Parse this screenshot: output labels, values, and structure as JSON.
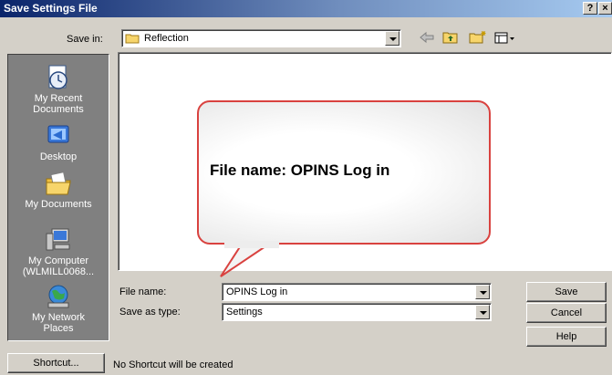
{
  "window": {
    "title": "Save Settings File",
    "help_button": "?",
    "close_button": "×"
  },
  "savein": {
    "label": "Save in:",
    "value": "Reflection"
  },
  "toolbar": {
    "icons": [
      "back-arrow-icon",
      "up-folder-icon",
      "new-folder-icon",
      "view-menu-icon"
    ]
  },
  "places": [
    {
      "label_line1": "My Recent",
      "label_line2": "Documents",
      "icon": "recent-documents-icon"
    },
    {
      "label_line1": "Desktop",
      "label_line2": "",
      "icon": "desktop-icon"
    },
    {
      "label_line1": "My Documents",
      "label_line2": "",
      "icon": "my-documents-icon"
    },
    {
      "label_line1": "My Computer",
      "label_line2": "(WLMILL0068...",
      "icon": "my-computer-icon"
    },
    {
      "label_line1": "My Network",
      "label_line2": "Places",
      "icon": "network-places-icon"
    }
  ],
  "callout": {
    "text": "File name:  OPINS Log in"
  },
  "filename": {
    "label": "File name:",
    "value": "OPINS Log in"
  },
  "savetype": {
    "label": "Save as type:",
    "value": "Settings"
  },
  "buttons": {
    "save": "Save",
    "cancel": "Cancel",
    "help": "Help",
    "shortcut": "Shortcut..."
  },
  "status": {
    "text": "No Shortcut will be created"
  },
  "colors": {
    "titlebar": "#0a246a",
    "dialog_bg": "#d4d0c8",
    "callout_border": "#d9423f"
  }
}
